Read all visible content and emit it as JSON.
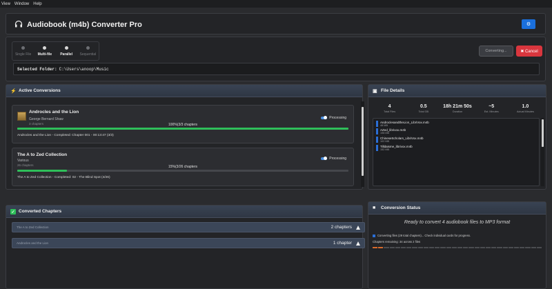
{
  "menu": [
    "View",
    "Window",
    "Help"
  ],
  "header": {
    "title": "Audiobook (m4b) Converter Pro",
    "settings_icon": "⚙"
  },
  "modes": [
    {
      "label": "Single File",
      "active": false
    },
    {
      "label": "Multi-file",
      "active": true
    },
    {
      "label": "Parallel",
      "active": true
    },
    {
      "label": "Sequential",
      "active": false
    }
  ],
  "buttons": {
    "converting": "Converting...",
    "cancel": "✖ Cancel"
  },
  "folder": {
    "label": "Selected Folder:",
    "path": "C:\\Users\\anoop\\Music"
  },
  "active_conversions": {
    "title": "Active Conversions",
    "cards": [
      {
        "title": "Androcles and the Lion",
        "author": "George Bernard Shaw",
        "chapters": "3 chapters",
        "status": "Processing",
        "progress_label": "100%(3/3 chapters",
        "progress": 1.0,
        "line": "Androcles and the Lion - Completed: Chapter 001 - 00:13:47 (3/3)"
      },
      {
        "title": "The A to Zed Collection",
        "author": "Various",
        "chapters": "26 chapters",
        "status": "Processing",
        "progress_label": "15%(3/26 chapters",
        "progress": 0.15,
        "line": "The A to Zed Collection - Completed: 02 - The Blind Spot (4/26)"
      }
    ]
  },
  "file_details": {
    "title": "File Details",
    "stats": [
      {
        "value": "4",
        "label": "Total Files"
      },
      {
        "value": "0.5",
        "label": "Total GB"
      },
      {
        "value": "18h 21m 50s",
        "label": "Duration"
      },
      {
        "value": "~5",
        "label": "Est. Minutes"
      },
      {
        "value": "1.0",
        "label": "Actual Minutes"
      }
    ],
    "files": [
      {
        "name": "AndroclesandtheLion_LibriVox.m4b",
        "size": "48 MB"
      },
      {
        "name": "AZed_librivox.m4b",
        "size": "198 MB"
      },
      {
        "name": "ChineseScholars_LibriVox.m4b",
        "size": "102 MB"
      },
      {
        "name": "Tilldaisme_librivox.m4b",
        "size": "152 MB"
      }
    ]
  },
  "converted": {
    "title": "Converted Chapters",
    "rows": [
      {
        "name": "The A to Zed Collection",
        "count": "2 chapters"
      },
      {
        "name": "Androcles and the Lion",
        "count": "1 chapter"
      }
    ]
  },
  "status": {
    "title": "Conversion Status",
    "ready": "Ready to convert 4 audiobook files to MP3 format",
    "info": "Converting files (29 total chapters)... Check individual cards for progress.",
    "remaining": "Chapters remaining: 34 across 2 files",
    "bar_segments": [
      1,
      1,
      0,
      0,
      0,
      0,
      0,
      0,
      0,
      0,
      0,
      0,
      0,
      0,
      0,
      0,
      0,
      0,
      0,
      0,
      0,
      0,
      0,
      0,
      0,
      0,
      0,
      0,
      0,
      0
    ],
    "bar_colors": {
      "done": "#d96a2b",
      "pending": "#4a4c50"
    }
  }
}
